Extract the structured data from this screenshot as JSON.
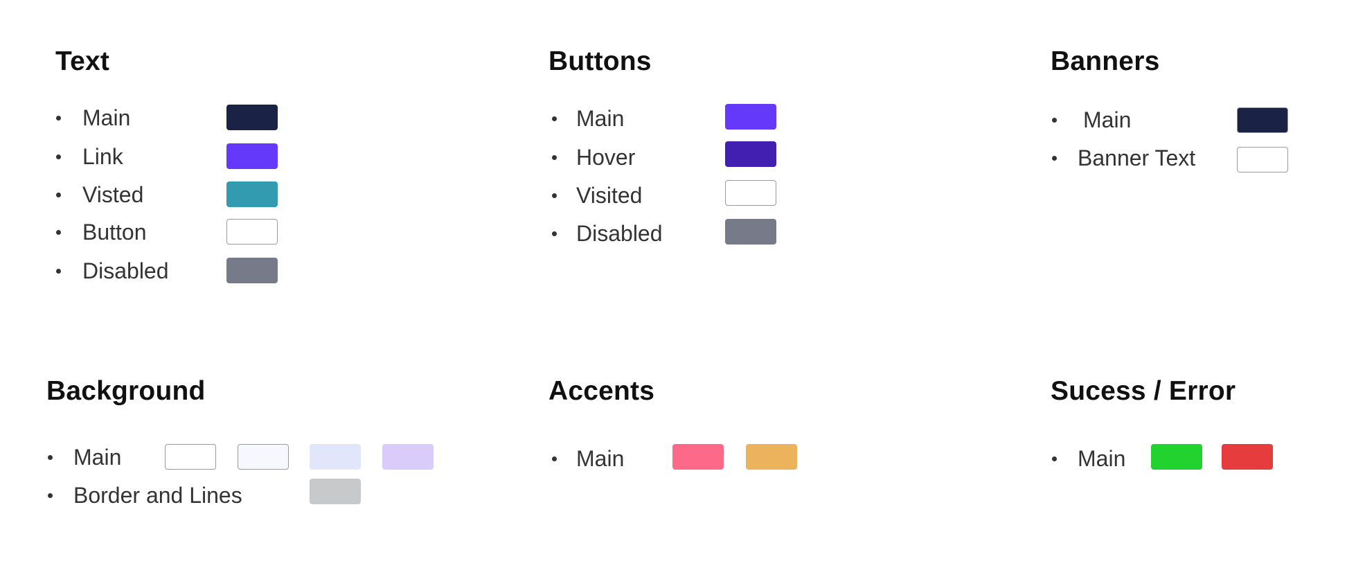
{
  "sections": {
    "text": {
      "title": "Text",
      "items": [
        {
          "label": "Main",
          "colors": [
            "#1a2245"
          ]
        },
        {
          "label": "Link",
          "colors": [
            "#6439fa"
          ]
        },
        {
          "label": "Visted",
          "colors": [
            "#329bb0"
          ]
        },
        {
          "label": "Button",
          "colors": [
            "#ffffff"
          ]
        },
        {
          "label": "Disabled",
          "colors": [
            "#767a89"
          ]
        }
      ]
    },
    "buttons": {
      "title": "Buttons",
      "items": [
        {
          "label": "Main",
          "colors": [
            "#6439fa"
          ]
        },
        {
          "label": "Hover",
          "colors": [
            "#421fb1"
          ]
        },
        {
          "label": "Visited",
          "colors": [
            "#ffffff"
          ]
        },
        {
          "label": "Disabled",
          "colors": [
            "#767a89"
          ]
        }
      ]
    },
    "banners": {
      "title": "Banners",
      "items": [
        {
          "label": "Main",
          "colors": [
            "#1a2245"
          ]
        },
        {
          "label": "Banner Text",
          "colors": [
            "#ffffff"
          ]
        }
      ]
    },
    "background": {
      "title": "Background",
      "items": [
        {
          "label": "Main",
          "colors": [
            "#ffffff",
            "#f7f8fd",
            "#e2e6fb",
            "#d9ccfb"
          ]
        },
        {
          "label": "Border and Lines",
          "colors": [
            "#c8c9cb"
          ]
        }
      ]
    },
    "accents": {
      "title": "Accents",
      "items": [
        {
          "label": "Main",
          "colors": [
            "#fd6a89",
            "#edb25c"
          ]
        }
      ]
    },
    "success_error": {
      "title": "Sucess / Error",
      "items": [
        {
          "label": "Main",
          "colors": [
            "#22d32f",
            "#e73c3e"
          ]
        }
      ]
    }
  }
}
